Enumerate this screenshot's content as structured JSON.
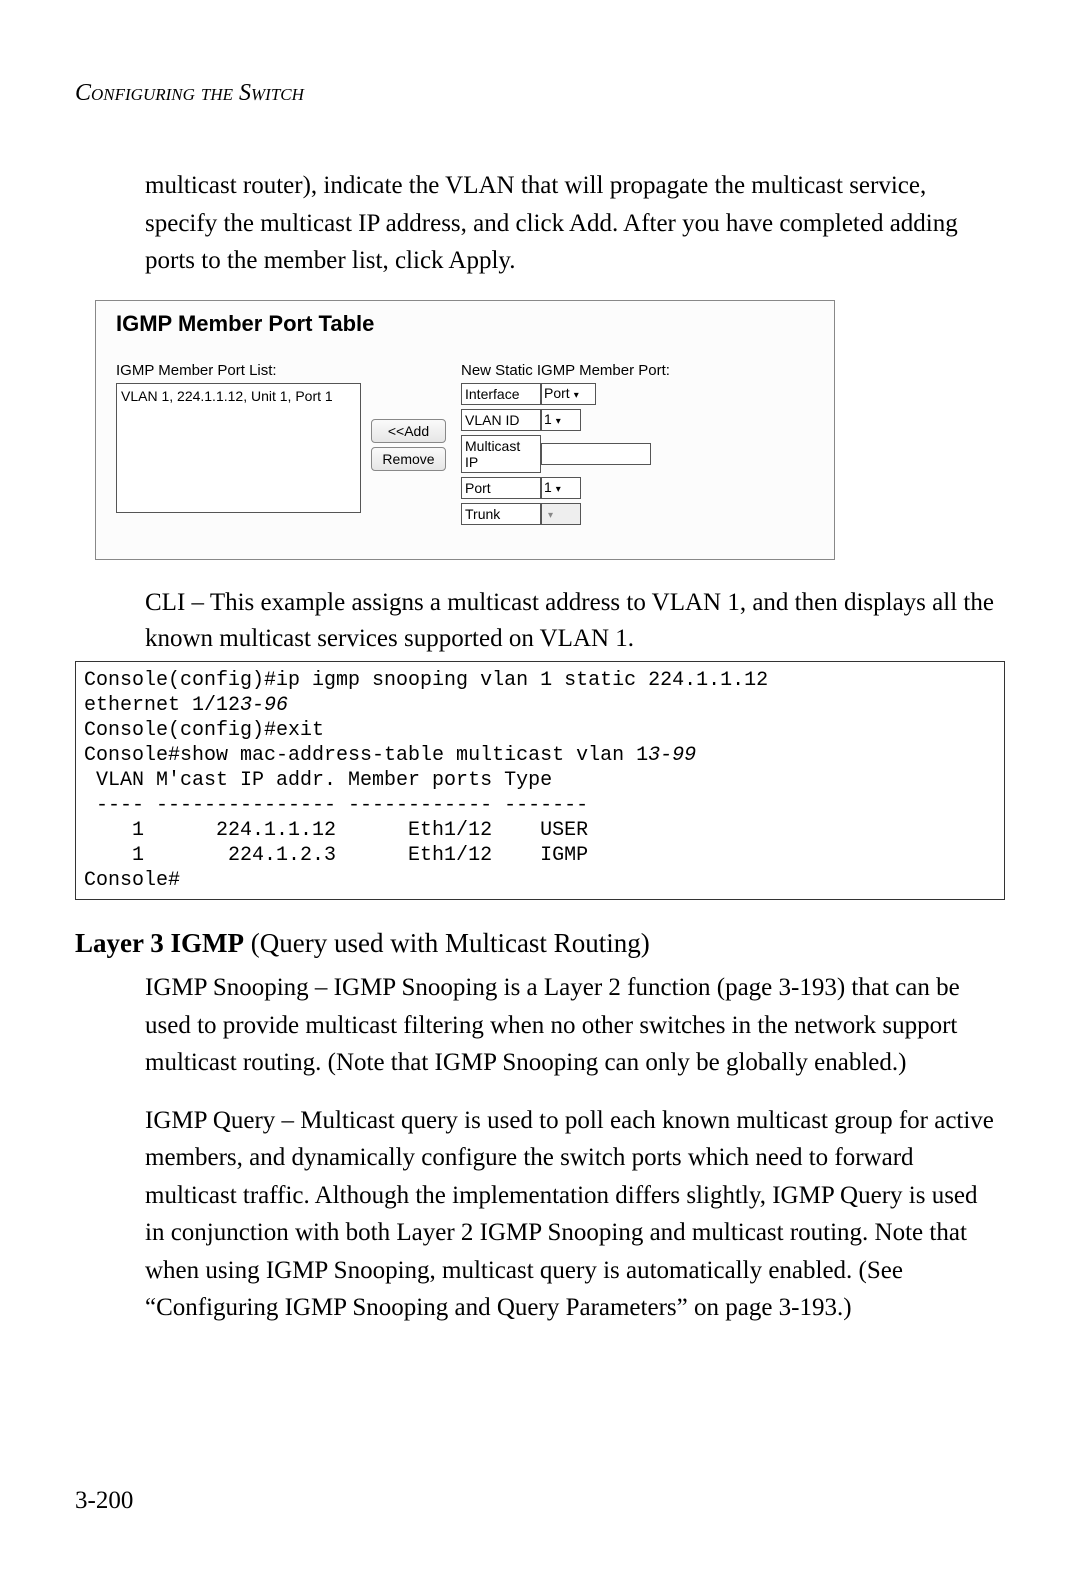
{
  "header": "Configuring the Switch",
  "intro_para": "multicast router), indicate the VLAN that will propagate the multicast service, specify the multicast IP address, and click Add. After you have completed adding ports to the member list, click Apply.",
  "panel": {
    "title": "IGMP Member Port Table",
    "list_label": "IGMP Member Port List:",
    "list_item": "VLAN 1, 224.1.1.12, Unit 1, Port 1",
    "btn_add": "<<Add",
    "btn_remove": "Remove",
    "new_label": "New Static IGMP Member Port:",
    "rows": {
      "interface": {
        "label": "Interface",
        "value": "Port"
      },
      "vlan": {
        "label": "VLAN ID",
        "value": "1"
      },
      "mcast": {
        "label": "Multicast IP",
        "value": ""
      },
      "port": {
        "label": "Port",
        "value": "1"
      },
      "trunk": {
        "label": "Trunk",
        "value": ""
      }
    }
  },
  "cli_para": "CLI – This example assigns a multicast address to VLAN 1, and then displays all the known multicast services supported on VLAN 1.",
  "code": {
    "l1": "Console(config)#ip igmp snooping vlan 1 static 224.1.1.12 ",
    "l2a": "ethernet 1/12",
    "l2b": "3-96",
    "l3": "Console(config)#exit",
    "l4a": "Console#show mac-address-table multicast vlan 1",
    "l4b": "3-99",
    "l5": " VLAN M'cast IP addr. Member ports Type",
    "l6": " ---- --------------- ------------ -------",
    "l7": "    1      224.1.1.12      Eth1/12    USER",
    "l8": "    1       224.1.2.3      Eth1/12    IGMP",
    "l9": "Console#"
  },
  "section": {
    "title_bold": "Layer 3 IGMP",
    "title_rest": " (Query used with Multicast Routing)",
    "p1": "IGMP Snooping – IGMP Snooping is a Layer 2 function (page 3-193) that can be used to provide multicast filtering when no other switches in the network support multicast routing. (Note that IGMP Snooping can only be globally enabled.)",
    "p2": "IGMP Query – Multicast query is used to poll each known multicast group for active members, and dynamically configure the switch ports which need to forward multicast traffic. Although the implementation differs slightly, IGMP Query is used in conjunction with both Layer 2 IGMP Snooping and multicast routing. Note that when using IGMP Snooping, multicast query is automatically enabled. (See “Configuring IGMP Snooping and Query Parameters” on page 3-193.)"
  },
  "page_number": "3-200"
}
